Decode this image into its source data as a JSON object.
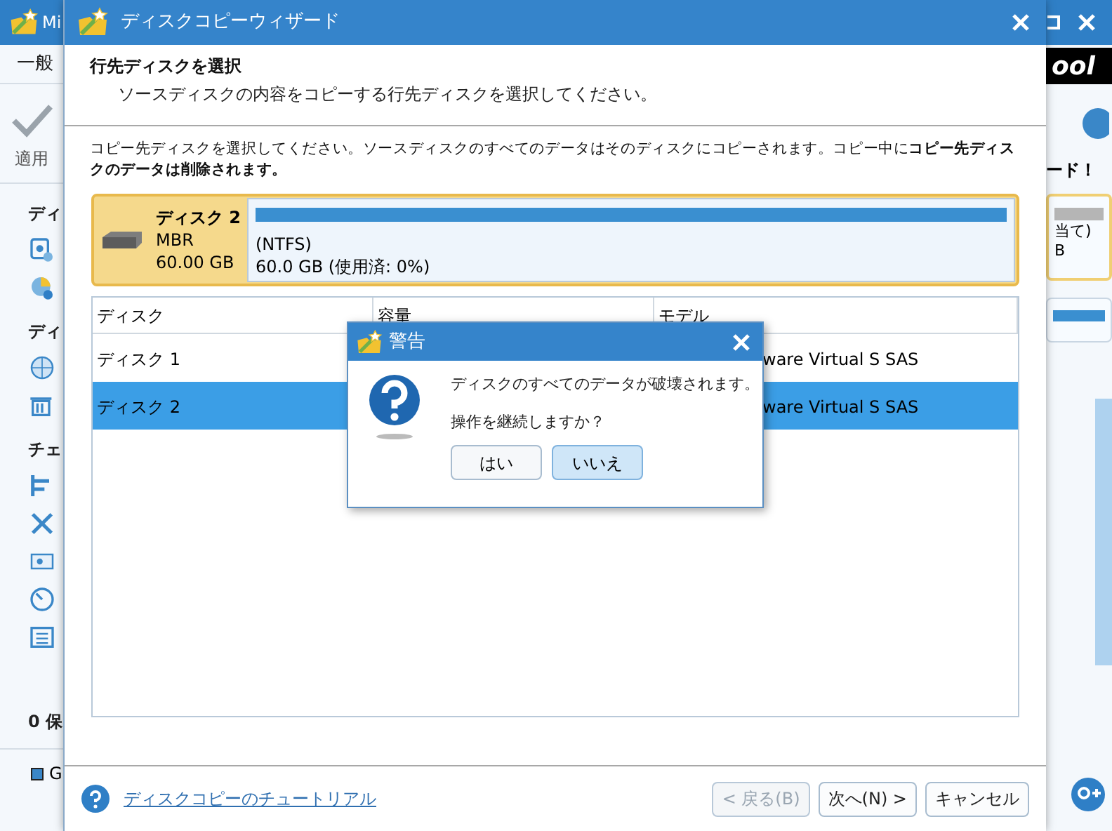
{
  "app": {
    "title": "Mi",
    "menu": "一般",
    "apply": "適用",
    "sections": [
      {
        "heading": "ディ"
      },
      {
        "heading": "ディ"
      },
      {
        "heading": "チェ"
      }
    ],
    "pending": "0 保",
    "legend": "G",
    "brand": "ool",
    "upgrade": "ード！",
    "disk_card": {
      "line_1": "当て)",
      "line_2": "B"
    }
  },
  "wizard": {
    "title": "ディスクコピーウィザード",
    "heading": "行先ディスクを選択",
    "subheading": "ソースディスクの内容をコピーする行先ディスクを選択してください。",
    "description": "コピー先ディスクを選択してください。ソースディスクのすべてのデータはそのディスクにコピーされます。コピー中に**コピー先ディスクのデータは削除されます。**",
    "disk": {
      "name": "ディスク 2",
      "style": "MBR",
      "size": "60.00 GB",
      "partition_fs": "(NTFS)",
      "partition_usage": "60.0 GB (使用済: 0%)"
    },
    "table": {
      "columns": [
        "ディスク",
        "容量",
        "モデル"
      ],
      "rows": [
        {
          "disk": "ディスク 1",
          "model": "ware Virtual S SAS",
          "selected": false
        },
        {
          "disk": "ディスク 2",
          "model": "ware Virtual S SAS",
          "selected": true
        }
      ]
    },
    "tutorial_link": "ディスクコピーのチュートリアル",
    "buttons": [
      {
        "label": "< 戻る(B)",
        "disabled": true
      },
      {
        "label": "次へ(N) >",
        "disabled": false
      },
      {
        "label": "キャンセル",
        "disabled": false
      }
    ]
  },
  "dialog": {
    "title": "警告",
    "message": "ディスクのすべてのデータが破壊されます。",
    "question": "操作を継続しますか？",
    "buttons": [
      {
        "label": "はい",
        "focused": false
      },
      {
        "label": "いいえ",
        "focused": true
      }
    ]
  }
}
